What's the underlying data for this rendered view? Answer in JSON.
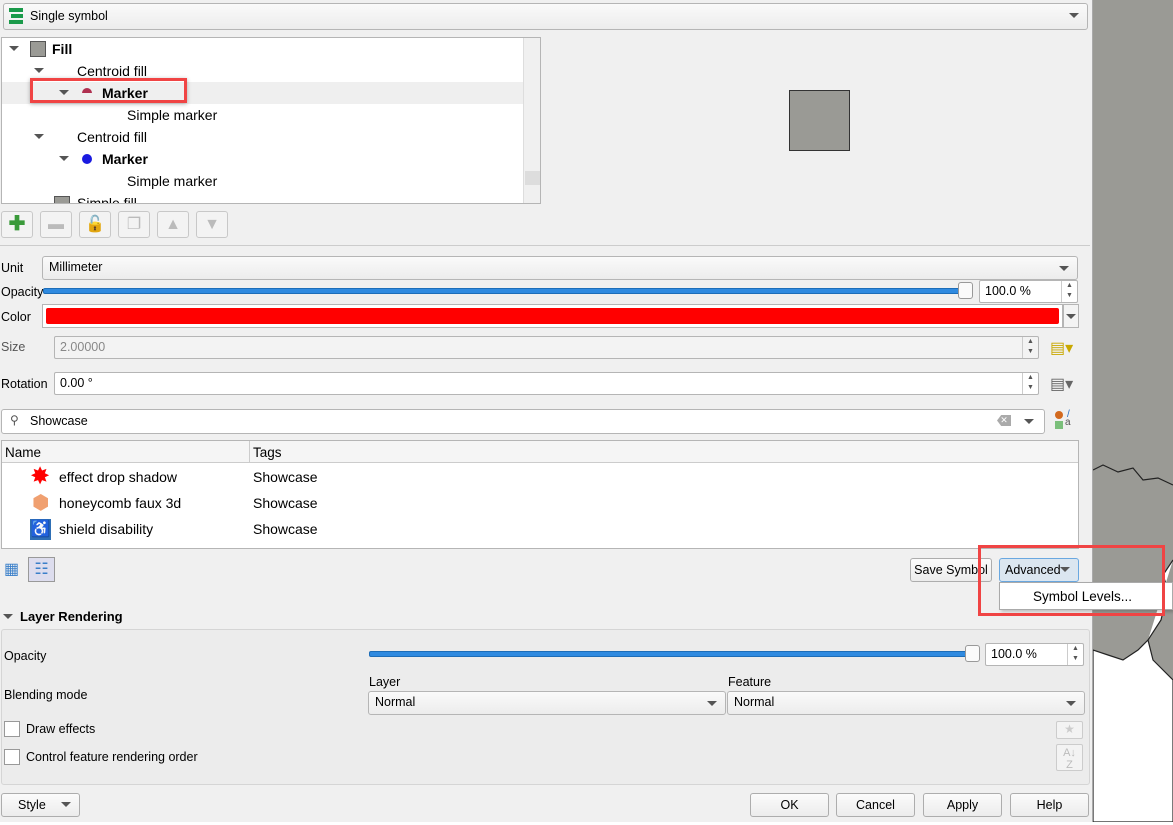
{
  "renderer": {
    "type": "Single symbol",
    "icon": "single-symbol-icon"
  },
  "tree": {
    "items": [
      {
        "label": "Fill",
        "bold": true,
        "icon": "fill-swatch-icon"
      },
      {
        "label": "Centroid fill"
      },
      {
        "label": "Marker",
        "bold": true,
        "icon": "half-circle-marker-icon",
        "selected": true
      },
      {
        "label": "Simple marker"
      },
      {
        "label": "Centroid fill"
      },
      {
        "label": "Marker",
        "bold": true,
        "icon": "blue-circle-marker-icon"
      },
      {
        "label": "Simple marker"
      },
      {
        "label": "Simple fill",
        "icon": "fill-swatch-icon"
      }
    ]
  },
  "layer_tools": [
    "add-layer",
    "remove-layer",
    "lock-layer",
    "duplicate-layer",
    "move-up",
    "move-down"
  ],
  "props": {
    "unit_label": "Unit",
    "unit_value": "Millimeter",
    "opacity_label": "Opacity",
    "opacity_value": "100.0 %",
    "opacity_fraction": 1.0,
    "color_label": "Color",
    "color_value": "#ff0000",
    "size_label": "Size",
    "size_value": "2.00000",
    "rotation_label": "Rotation",
    "rotation_value": "0.00 °"
  },
  "library": {
    "search_value": "Showcase",
    "columns": [
      "Name",
      "Tags"
    ],
    "rows": [
      {
        "name": "effect drop shadow",
        "tags": "Showcase",
        "icon": "red-star-icon"
      },
      {
        "name": "honeycomb faux 3d",
        "tags": "Showcase",
        "icon": "hexagon-icon"
      },
      {
        "name": "shield disability",
        "tags": "Showcase",
        "icon": "wheelchair-icon"
      }
    ],
    "save_symbol": "Save Symbol",
    "advanced": "Advanced",
    "menu_item": "Symbol Levels..."
  },
  "layer_rendering": {
    "title": "Layer Rendering",
    "opacity_label": "Opacity",
    "opacity_value": "100.0 %",
    "opacity_fraction": 1.0,
    "blending_label": "Blending mode",
    "layer_label": "Layer",
    "layer_value": "Normal",
    "feature_label": "Feature",
    "feature_value": "Normal",
    "draw_effects": "Draw effects",
    "control_order": "Control feature rendering order"
  },
  "footer": {
    "style": "Style",
    "ok": "OK",
    "cancel": "Cancel",
    "apply": "Apply",
    "help": "Help"
  }
}
